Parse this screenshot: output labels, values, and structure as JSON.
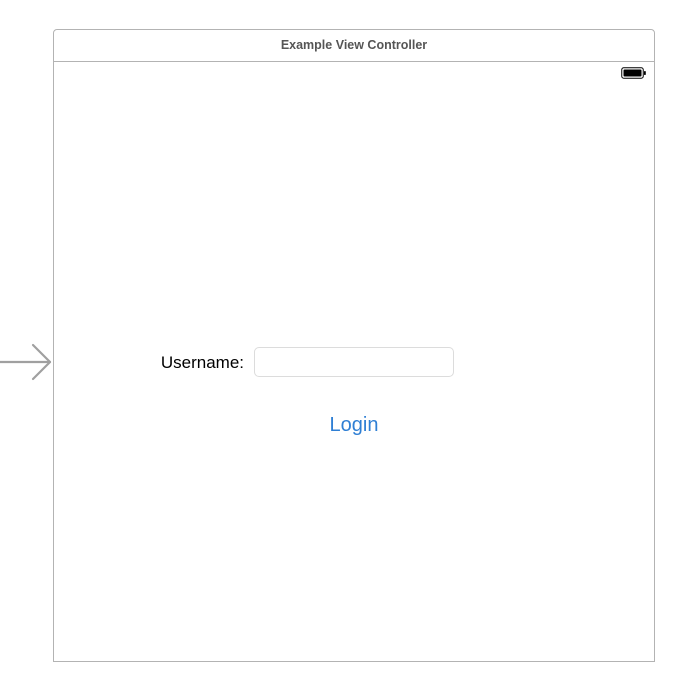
{
  "scene": {
    "title": "Example View Controller"
  },
  "status_bar": {
    "battery_icon": "battery-full-icon"
  },
  "entry_point": {
    "icon": "initial-view-controller-arrow-icon"
  },
  "form": {
    "username_label": "Username:",
    "username_value": "",
    "username_placeholder": "",
    "login_label": "Login"
  },
  "colors": {
    "tint": "#2f7fd4",
    "frame_border": "#b3b3b3",
    "arrow": "#a0a0a0",
    "title_text": "#555555"
  }
}
